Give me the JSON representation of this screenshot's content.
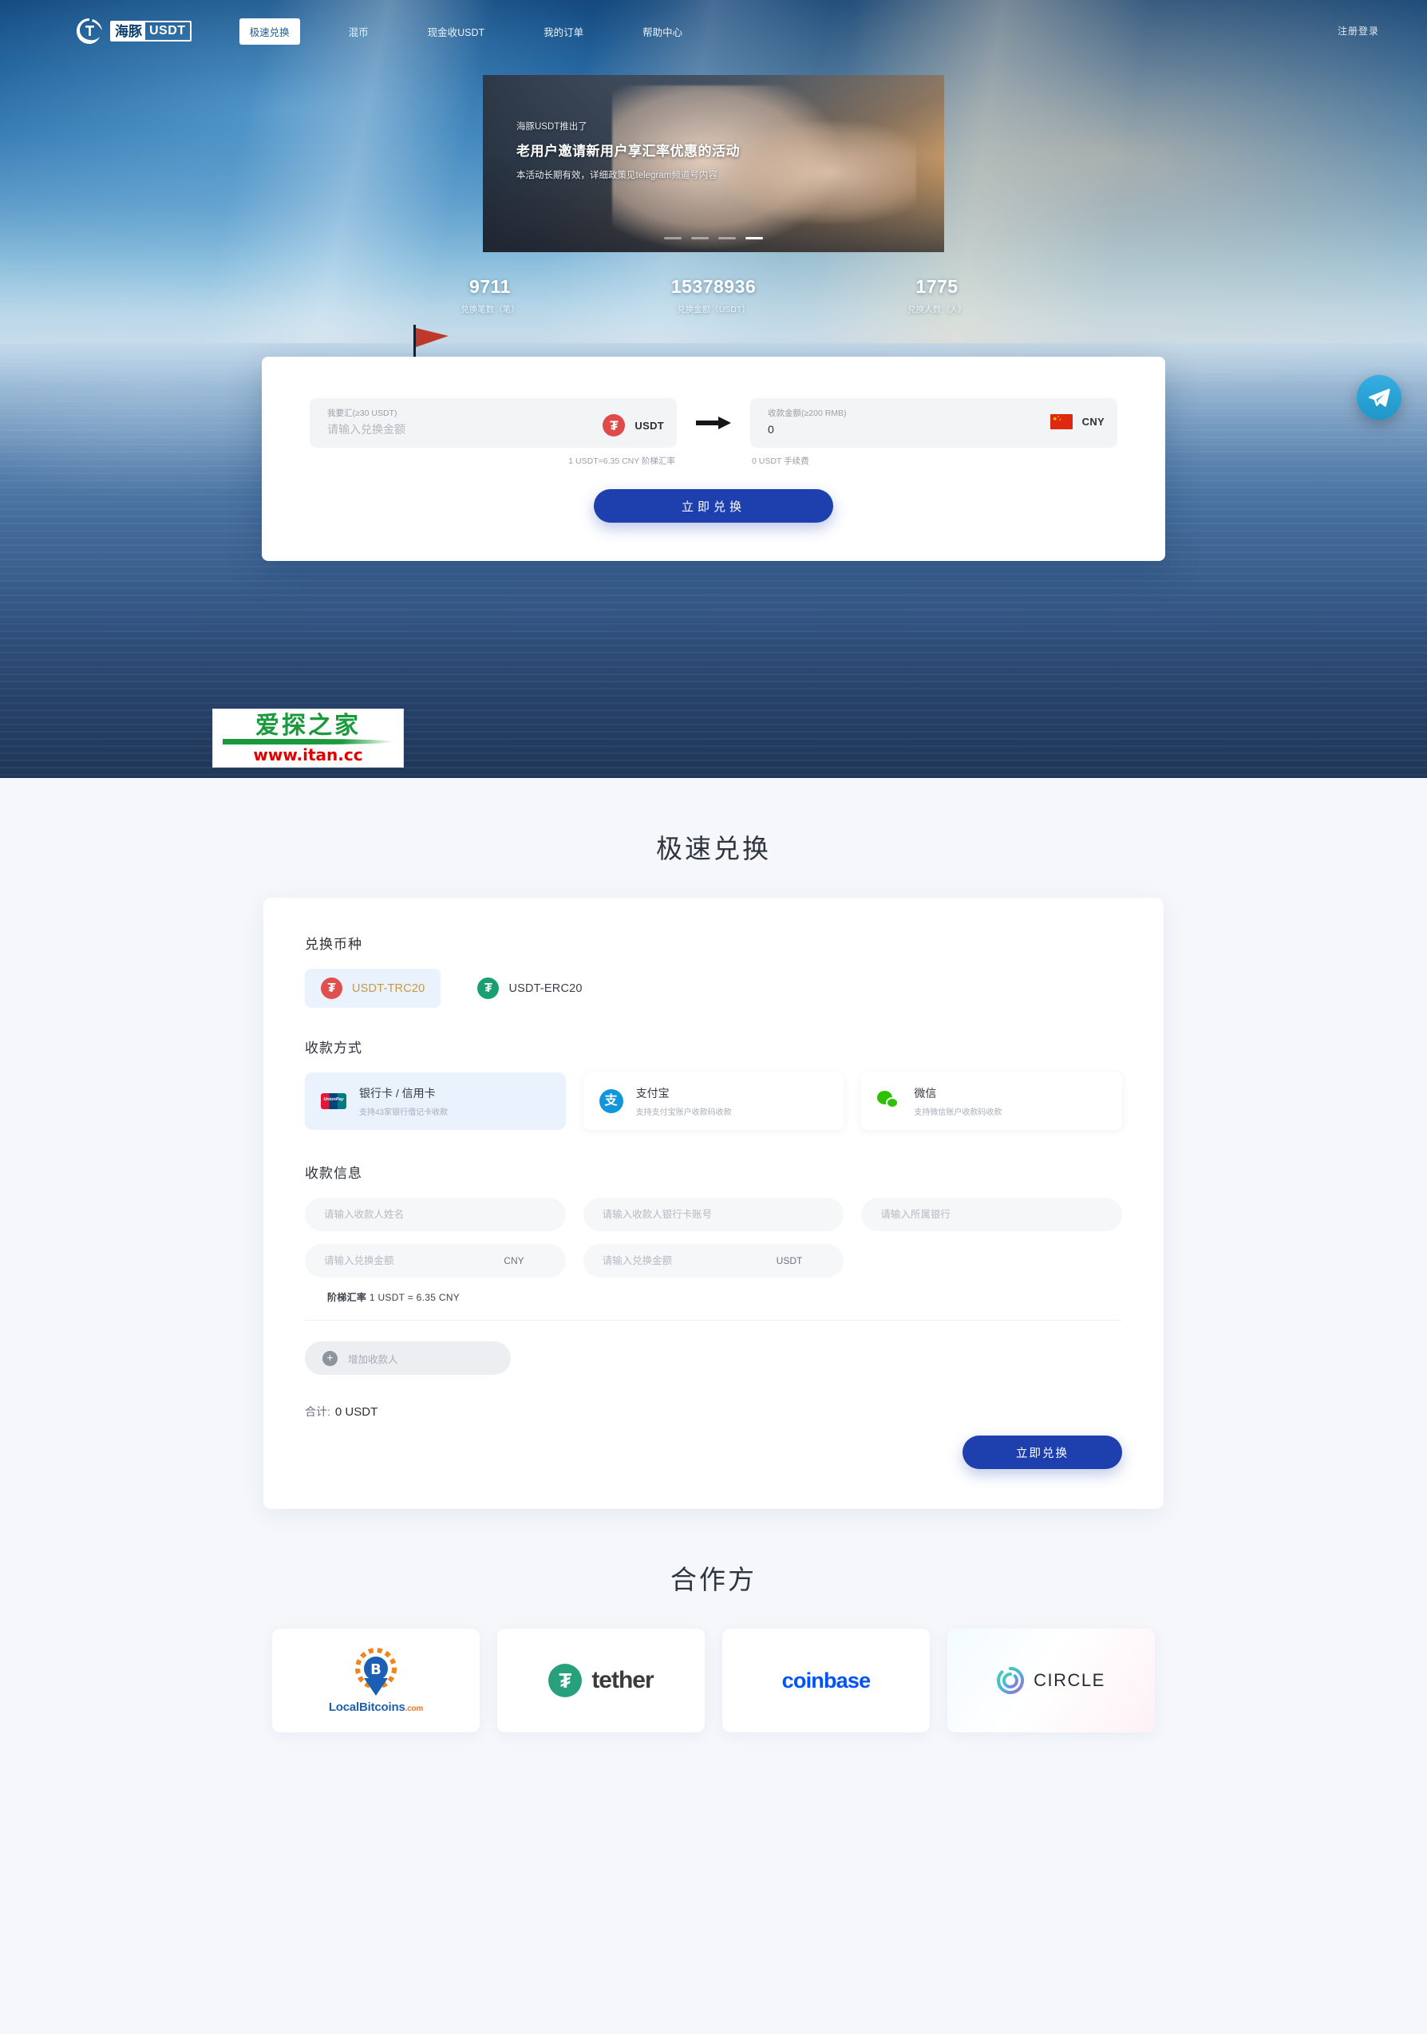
{
  "nav": {
    "logo_cn": "海豚",
    "logo_en": "USDT",
    "links": [
      {
        "label": "极速兑换",
        "active": true
      },
      {
        "label": "混币",
        "active": false
      },
      {
        "label": "现金收USDT",
        "active": false
      },
      {
        "label": "我的订单",
        "active": false
      },
      {
        "label": "帮助中心",
        "active": false
      }
    ],
    "auth_label": "注册登录"
  },
  "banner": {
    "eyebrow": "海豚USDT推出了",
    "title": "老用户邀请新用户享汇率优惠的活动",
    "subtitle": "本活动长期有效，详细政策见telegram频道号内容",
    "dots": 4,
    "active_dot": 4
  },
  "stats": [
    {
      "value": "9711",
      "label": "兑换笔数（笔）"
    },
    {
      "value": "15378936",
      "label": "兑换金额（USDT）"
    },
    {
      "value": "1775",
      "label": "兑换人数（人）"
    }
  ],
  "exchange": {
    "from": {
      "label": "我要汇(≥30 USDT)",
      "placeholder": "请输入兑换金额",
      "value": "",
      "currency": "USDT",
      "icon": "tether-icon",
      "hint": "1 USDT=6.35 CNY 阶梯汇率"
    },
    "to": {
      "label": "收款金额(≥200 RMB)",
      "value": "0",
      "currency": "CNY",
      "icon": "china-flag-icon",
      "hint": "0 USDT 手续费"
    },
    "submit_label": "立即兑换"
  },
  "watermark": {
    "text_cn": "爱探之家",
    "url": "www.itan.cc"
  },
  "main": {
    "title": "极速兑换",
    "coin_section_title": "兑换币种",
    "coins": [
      {
        "label": "USDT-TRC20",
        "selected": true,
        "icon": "tether-trc20-icon"
      },
      {
        "label": "USDT-ERC20",
        "selected": false,
        "icon": "tether-erc20-icon"
      }
    ],
    "pay_section_title": "收款方式",
    "pay_methods": [
      {
        "title": "银行卡 / 信用卡",
        "desc": "支持43家银行借记卡收款",
        "selected": true,
        "icon": "unionpay-icon"
      },
      {
        "title": "支付宝",
        "desc": "支持支付宝账户收款码收款",
        "selected": false,
        "icon": "alipay-icon"
      },
      {
        "title": "微信",
        "desc": "支持微信账户收款码收款",
        "selected": false,
        "icon": "wechat-icon"
      }
    ],
    "info_section_title": "收款信息",
    "fields": {
      "payee_name": {
        "placeholder": "请输入收款人姓名",
        "value": ""
      },
      "bank_account": {
        "placeholder": "请输入收款人银行卡账号",
        "value": ""
      },
      "bank_name": {
        "placeholder": "请输入所属银行",
        "value": ""
      },
      "amount_cny": {
        "placeholder": "请输入兑换金额",
        "value": "",
        "unit": "CNY"
      },
      "amount_usdt": {
        "placeholder": "请输入兑换金额",
        "value": "",
        "unit": "USDT"
      }
    },
    "rate_label": "阶梯汇率",
    "rate_text": "1 USDT = 6.35 CNY",
    "add_payee_label": "增加收款人",
    "total_label": "合计:",
    "total_value": "0 USDT",
    "submit_label": "立即兑换"
  },
  "partners": {
    "title": "合作方",
    "items": [
      {
        "name": "LocalBitcoins",
        "suffix": ".com",
        "type": "localbitcoins"
      },
      {
        "name": "tether",
        "type": "tether"
      },
      {
        "name": "coinbase",
        "type": "coinbase"
      },
      {
        "name": "CIRCLE",
        "type": "circle"
      }
    ]
  },
  "colors": {
    "primary_blue": "#1e3fae",
    "hero_blue": "#14548f",
    "accent_gold": "#c69a3e",
    "tether_green": "#26a17b",
    "coinbase_blue": "#0052ff"
  },
  "float": {
    "telegram_label": "telegram-icon"
  }
}
